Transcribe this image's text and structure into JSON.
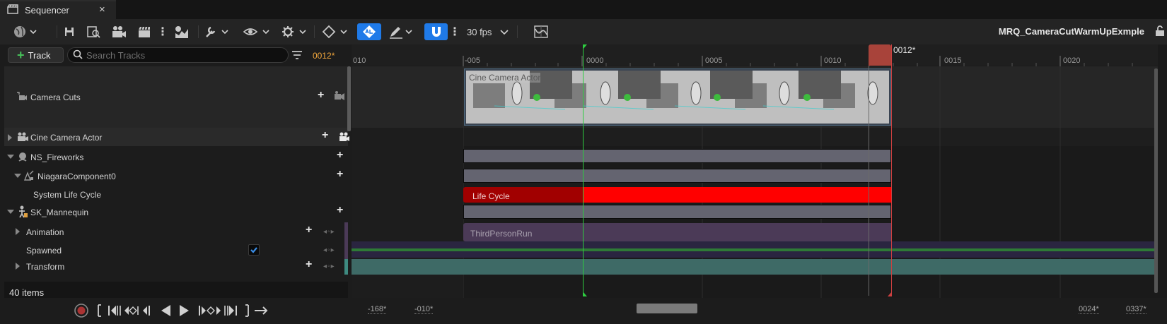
{
  "window": {
    "tab_title": "Sequencer",
    "close_glyph": "×",
    "sequence_name": "MRQ_CameraCutWarmUpExmple"
  },
  "toolbar": {
    "fps_label": "30 fps"
  },
  "track_panel": {
    "add_track_label": "Track",
    "add_track_glyph": "+",
    "search_placeholder": "Search Tracks",
    "current_frame": "0012*",
    "items_count": "40 items"
  },
  "tracks": [
    {
      "label": "Camera Cuts"
    },
    {
      "label": "Cine Camera Actor"
    },
    {
      "label": "NS_Fireworks"
    },
    {
      "label": "NiagaraComponent0"
    },
    {
      "label": "System Life Cycle"
    },
    {
      "label": "SK_Mannequin"
    },
    {
      "label": "Animation"
    },
    {
      "label": "Spawned"
    },
    {
      "label": "Transform"
    }
  ],
  "timeline": {
    "ruler_ticks": [
      "010",
      "-005",
      "0000",
      "0005",
      "0010",
      "0015",
      "0020"
    ],
    "playhead_label": "0012*",
    "camera_cut_section_label": "Cine Camera Actor",
    "life_cycle_section_label": "Life Cycle",
    "animation_section_label": "ThirdPersonRun",
    "view_start": "-168*",
    "working_start": "-010*",
    "working_end": "0024*",
    "view_end": "0337*"
  },
  "colors": {
    "accent_blue": "#1f7ae8",
    "playhead": "#c0504a",
    "start_marker": "#2ecc40",
    "life_cycle_red": "#ff0000",
    "frame_orange": "#f0a63c"
  }
}
